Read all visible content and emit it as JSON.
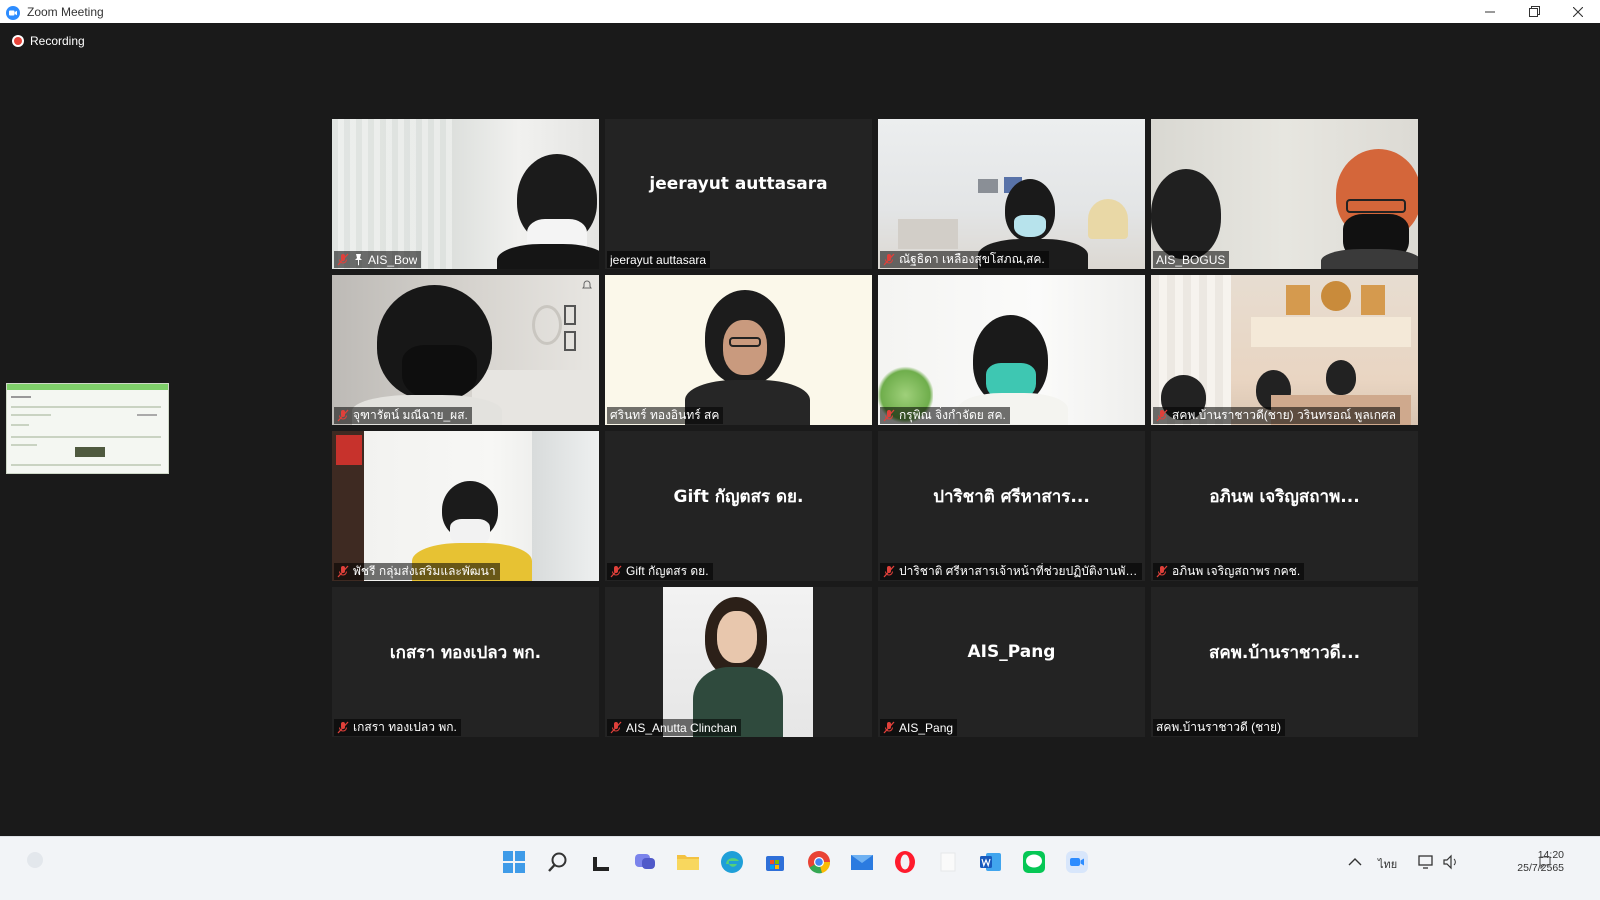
{
  "window": {
    "title": "Zoom Meeting"
  },
  "recording": {
    "label": "Recording"
  },
  "participants": [
    {
      "label": "AIS_Bow",
      "center": "",
      "muted": true,
      "pinned": true,
      "video": true
    },
    {
      "label": "jeerayut auttasara",
      "center": "jeerayut auttasara",
      "muted": false,
      "pinned": false,
      "video": false
    },
    {
      "label": "ณัฐธิดา เหลืองสุขโสภณ,สค.",
      "center": "",
      "muted": true,
      "pinned": false,
      "video": true
    },
    {
      "label": "AIS_BOGUS",
      "center": "",
      "muted": false,
      "pinned": false,
      "video": true
    },
    {
      "label": "จุฑารัตน์ มณีฉาย_ผส.",
      "center": "",
      "muted": true,
      "pinned": false,
      "video": true
    },
    {
      "label": "ศรินทร์ ทองอินทร์ สค",
      "center": "",
      "muted": false,
      "pinned": false,
      "video": true,
      "speaking": true
    },
    {
      "label": "กรุพิณ จิ่งกำจัดย สค.",
      "center": "",
      "muted": true,
      "pinned": false,
      "video": true
    },
    {
      "label": "สคพ.บ้านราชาวดี(ชาย) วรินทรอณ์ พูลเกศล",
      "center": "",
      "muted": true,
      "pinned": false,
      "video": true
    },
    {
      "label": "พัชรี กลุ่มส่งเสริมและพัฒนา",
      "center": "",
      "muted": true,
      "pinned": false,
      "video": true
    },
    {
      "label": "Gift กัญตสร ดย.",
      "center": "Gift กัญตสร ดย.",
      "muted": true,
      "pinned": false,
      "video": false
    },
    {
      "label": "ปาริชาติ ศรีหาสารเจ้าหน้าที่ช่วยปฏิบัติงานพัฒน...",
      "center": "ปาริชาติ ศรีหาสาร...",
      "muted": true,
      "pinned": false,
      "video": false
    },
    {
      "label": "อภินพ เจริญสถาพร กคช.",
      "center": "อภินพ เจริญสถาพ...",
      "muted": true,
      "pinned": false,
      "video": false
    },
    {
      "label": "เกสรา ทองเปลว พก.",
      "center": "เกสรา ทองเปลว พก.",
      "muted": true,
      "pinned": false,
      "video": false
    },
    {
      "label": "AIS_Anutta Clinchan",
      "center": "",
      "muted": true,
      "pinned": false,
      "video": true
    },
    {
      "label": "AIS_Pang",
      "center": "AIS_Pang",
      "muted": true,
      "pinned": false,
      "video": false
    },
    {
      "label": "สคพ.บ้านราชาวดี (ชาย)",
      "center": "สคพ.บ้านราชาวดี...",
      "muted": false,
      "pinned": false,
      "video": false
    }
  ],
  "tray": {
    "language": "ไทย",
    "time": "14:20",
    "date": "25/7/2565"
  },
  "colors": {
    "tile_bg": "#232323",
    "speaker_outline": "#f0e56a",
    "mute_red": "#e0403a"
  },
  "icons": [
    "zoom-icon",
    "minimize-icon",
    "maximize-icon",
    "close-icon",
    "mic-muted-icon",
    "pin-icon",
    "windows-start-icon",
    "search-icon",
    "task-view-icon",
    "chat-icon",
    "file-explorer-icon",
    "edge-icon",
    "store-icon",
    "chrome-icon",
    "mail-icon",
    "opera-icon",
    "notepad-icon",
    "word-icon",
    "line-icon",
    "zoom-taskbar-icon"
  ]
}
